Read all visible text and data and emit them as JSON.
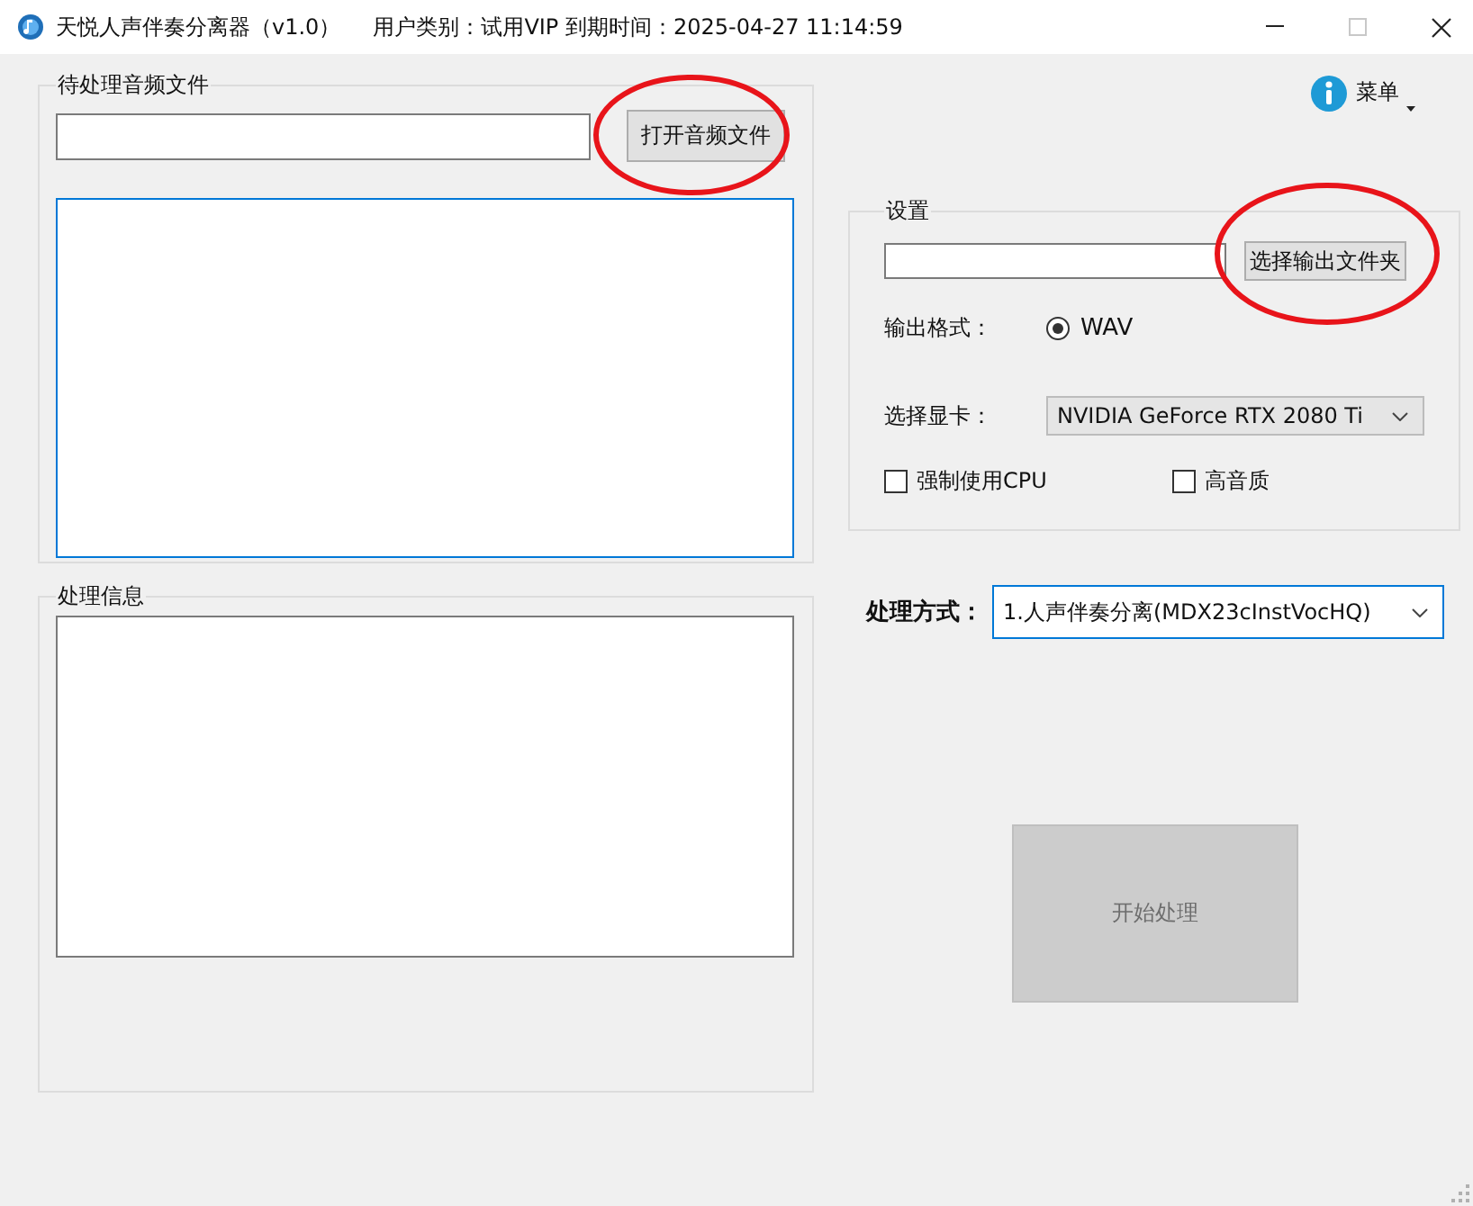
{
  "window": {
    "title": "天悦人声伴奏分离器（v1.0）",
    "info": "用户类别：试用VIP 到期时间：2025-04-27 11:14:59",
    "maximize_disabled": true
  },
  "menu": {
    "label": "菜单"
  },
  "input_group": {
    "title": "待处理音频文件",
    "button": {
      "label": "打开音频文件",
      "highlighted": true
    }
  },
  "log_group": {
    "title": "处理信息"
  },
  "settings": {
    "title": "设置",
    "output_button": {
      "label": "选择输出文件夹",
      "highlighted": true
    },
    "format_label": "输出格式：",
    "formats": [
      {
        "label": "WAV",
        "selected": true
      }
    ],
    "gpu_label": "选择显卡：",
    "gpu": "NVIDIA GeForce RTX 2080 Ti",
    "options": [
      {
        "label": "强制使用CPU",
        "checked": false
      },
      {
        "label": "高音质",
        "checked": false
      }
    ]
  },
  "method": {
    "label": "处理方式：",
    "value": "1.人声伴奏分离(MDX23cInstVocHQ)"
  },
  "start_button": {
    "label": "开始处理",
    "disabled": true
  }
}
